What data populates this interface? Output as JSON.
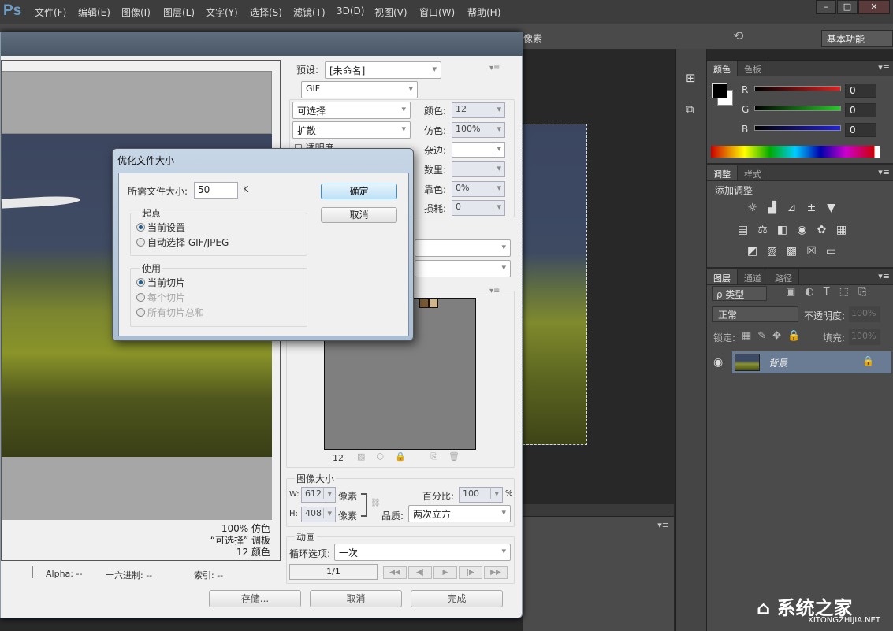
{
  "app": {
    "logo": "Ps",
    "menus": [
      "文件(F)",
      "编辑(E)",
      "图像(I)",
      "图层(L)",
      "文字(Y)",
      "选择(S)",
      "滤镜(T)",
      "3D(D)",
      "视图(V)",
      "窗口(W)",
      "帮助(H)"
    ],
    "window_controls": [
      "–",
      "□",
      "✕"
    ],
    "options_tail": "像素",
    "workspace": "基本功能"
  },
  "color_panel": {
    "tabs": [
      "颜色",
      "色板"
    ],
    "channels": [
      {
        "label": "R",
        "value": "0",
        "color": "#d02020"
      },
      {
        "label": "G",
        "value": "0",
        "color": "#20c020"
      },
      {
        "label": "B",
        "value": "0",
        "color": "#2020d0"
      }
    ]
  },
  "adjust_panel": {
    "tabs": [
      "调整",
      "样式"
    ],
    "heading": "添加调整",
    "icons": [
      [
        "brightness-icon",
        "levels-icon",
        "curves-icon",
        "exposure-icon",
        "vibrance-icon"
      ],
      [
        "hue-saturation-icon",
        "color-balance-icon",
        "black-white-icon",
        "photo-filter-icon",
        "channel-mixer-icon",
        "color-lookup-icon"
      ],
      [
        "invert-icon",
        "posterize-icon",
        "threshold-icon",
        "selective-color-icon",
        "gradient-map-icon"
      ]
    ]
  },
  "layers_panel": {
    "tabs": [
      "图层",
      "通道",
      "路径"
    ],
    "filter": "ρ 类型",
    "blend_mode": "正常",
    "opacity_label": "不透明度:",
    "opacity": "100%",
    "lock_label": "锁定:",
    "fill_label": "填充:",
    "fill": "100%",
    "layers": [
      {
        "name": "背景",
        "visible": true,
        "locked": true
      }
    ]
  },
  "save_dialog": {
    "preview_info": [
      "100% 仿色",
      "“可选择” 调板",
      "12 颜色"
    ],
    "status": {
      "alpha": "Alpha: --",
      "hex": "十六进制: --",
      "index": "索引: --"
    },
    "buttons": {
      "save": "存储...",
      "cancel": "取消",
      "done": "完成"
    },
    "preset_label": "预设:",
    "preset": "[未命名]",
    "format": "GIF",
    "reduction": "可选择",
    "dither_algo": "扩散",
    "colors_label": "颜色:",
    "colors": "12",
    "dither_label": "仿色:",
    "dither": "100%",
    "matte_label": "杂边:",
    "matte": "",
    "amount_label": "数里:",
    "amount": "",
    "websnap_label": "靠色:",
    "websnap": "0%",
    "lossy_label": "损耗:",
    "lossy": "0",
    "transparency": "透明度",
    "color_table_count": "12",
    "color_table_swatches": [
      "#7a5a32",
      "#d0b48c"
    ],
    "image_size": {
      "title": "图像大小",
      "w_label": "W:",
      "w": "612",
      "h_label": "H:",
      "h": "408",
      "unit": "像素",
      "percent_label": "百分比:",
      "percent": "100",
      "percent_unit": "%",
      "quality_label": "品质:",
      "quality": "两次立方"
    },
    "animation": {
      "title": "动画",
      "loop_label": "循环选项:",
      "loop": "一次",
      "frame": "1/1",
      "nav": [
        "◀◀",
        "◀|",
        "▶",
        "|▶",
        "▶▶"
      ]
    }
  },
  "optimize_dialog": {
    "title": "优化文件大小",
    "size_label": "所需文件大小:",
    "size": "50",
    "unit": "K",
    "ok": "确定",
    "cancel": "取消",
    "start_group": "起点",
    "start_options": [
      {
        "label": "当前设置",
        "checked": true,
        "enabled": true
      },
      {
        "label": "自动选择 GIF/JPEG",
        "checked": false,
        "enabled": true
      }
    ],
    "use_group": "使用",
    "use_options": [
      {
        "label": "当前切片",
        "checked": true,
        "enabled": true
      },
      {
        "label": "每个切片",
        "checked": false,
        "enabled": false
      },
      {
        "label": "所有切片总和",
        "checked": false,
        "enabled": false
      }
    ]
  },
  "watermark": {
    "text": "系统之家",
    "sub": "XITONGZHIJIA.NET"
  }
}
